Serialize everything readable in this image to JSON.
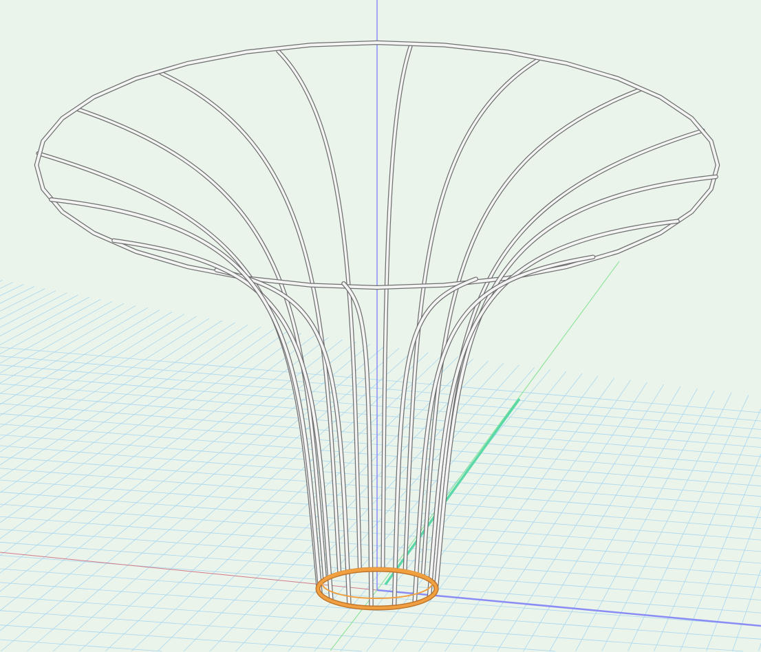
{
  "viewport": {
    "view_type": "3D perspective",
    "colors": {
      "background": "#eaf4ea",
      "grid": "#a9d6f0",
      "axis_x": "#d07a88",
      "axis_y": "#7fe08f",
      "axis_z": "#8a8cf5",
      "tube_edge": "#6f6f6f",
      "tube_fill": "#f4f4f4",
      "selected": "#f0a040"
    },
    "model": {
      "name": "wire-trumpet-frame",
      "rib_count": 16,
      "selected_part": "base-ring"
    }
  }
}
